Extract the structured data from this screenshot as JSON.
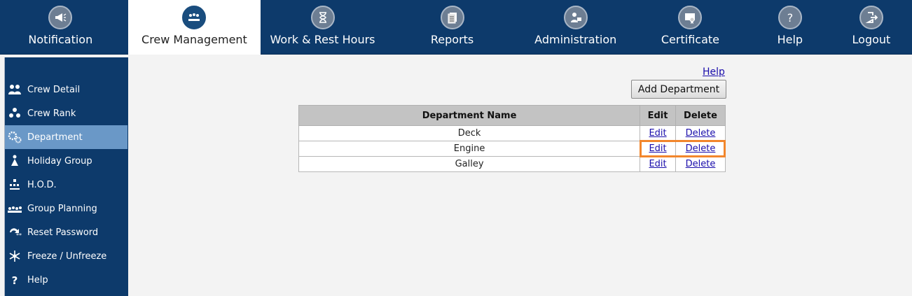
{
  "topnav": {
    "items": [
      {
        "label": "Notification",
        "icon": "megaphone-icon"
      },
      {
        "label": "Crew Management",
        "icon": "crew-group-icon"
      },
      {
        "label": "Work & Rest Hours",
        "icon": "hourglass-icon"
      },
      {
        "label": "Reports",
        "icon": "reports-icon"
      },
      {
        "label": "Administration",
        "icon": "admin-icon"
      },
      {
        "label": "Certificate",
        "icon": "certificate-icon"
      },
      {
        "label": "Help",
        "icon": "question-icon"
      },
      {
        "label": "Logout",
        "icon": "logout-icon"
      }
    ],
    "active": "Crew Management"
  },
  "sidebar": {
    "items": [
      {
        "label": "Crew Detail",
        "icon": "people-icon"
      },
      {
        "label": "Crew Rank",
        "icon": "rank-icon"
      },
      {
        "label": "Department",
        "icon": "gears-icon"
      },
      {
        "label": "Holiday Group",
        "icon": "person-relax-icon"
      },
      {
        "label": "H.O.D.",
        "icon": "hierarchy-icon"
      },
      {
        "label": "Group Planning",
        "icon": "group-planning-icon"
      },
      {
        "label": "Reset Password",
        "icon": "reset-password-icon"
      },
      {
        "label": "Freeze / Unfreeze",
        "icon": "snowflake-icon"
      },
      {
        "label": "Help",
        "icon": "question-icon"
      }
    ],
    "active": "Department"
  },
  "main": {
    "help_link": "Help",
    "add_button": "Add Department",
    "table": {
      "headers": [
        "Department Name",
        "Edit",
        "Delete"
      ],
      "rows": [
        {
          "name": "Deck",
          "edit": "Edit",
          "delete": "Delete"
        },
        {
          "name": "Engine",
          "edit": "Edit",
          "delete": "Delete"
        },
        {
          "name": "Galley",
          "edit": "Edit",
          "delete": "Delete"
        }
      ]
    },
    "highlight_color": "#f2862c"
  },
  "colors": {
    "nav_bg": "#0d3a6b",
    "sidebar_active": "#6a98c7",
    "page_bg": "#f3f3f3"
  }
}
